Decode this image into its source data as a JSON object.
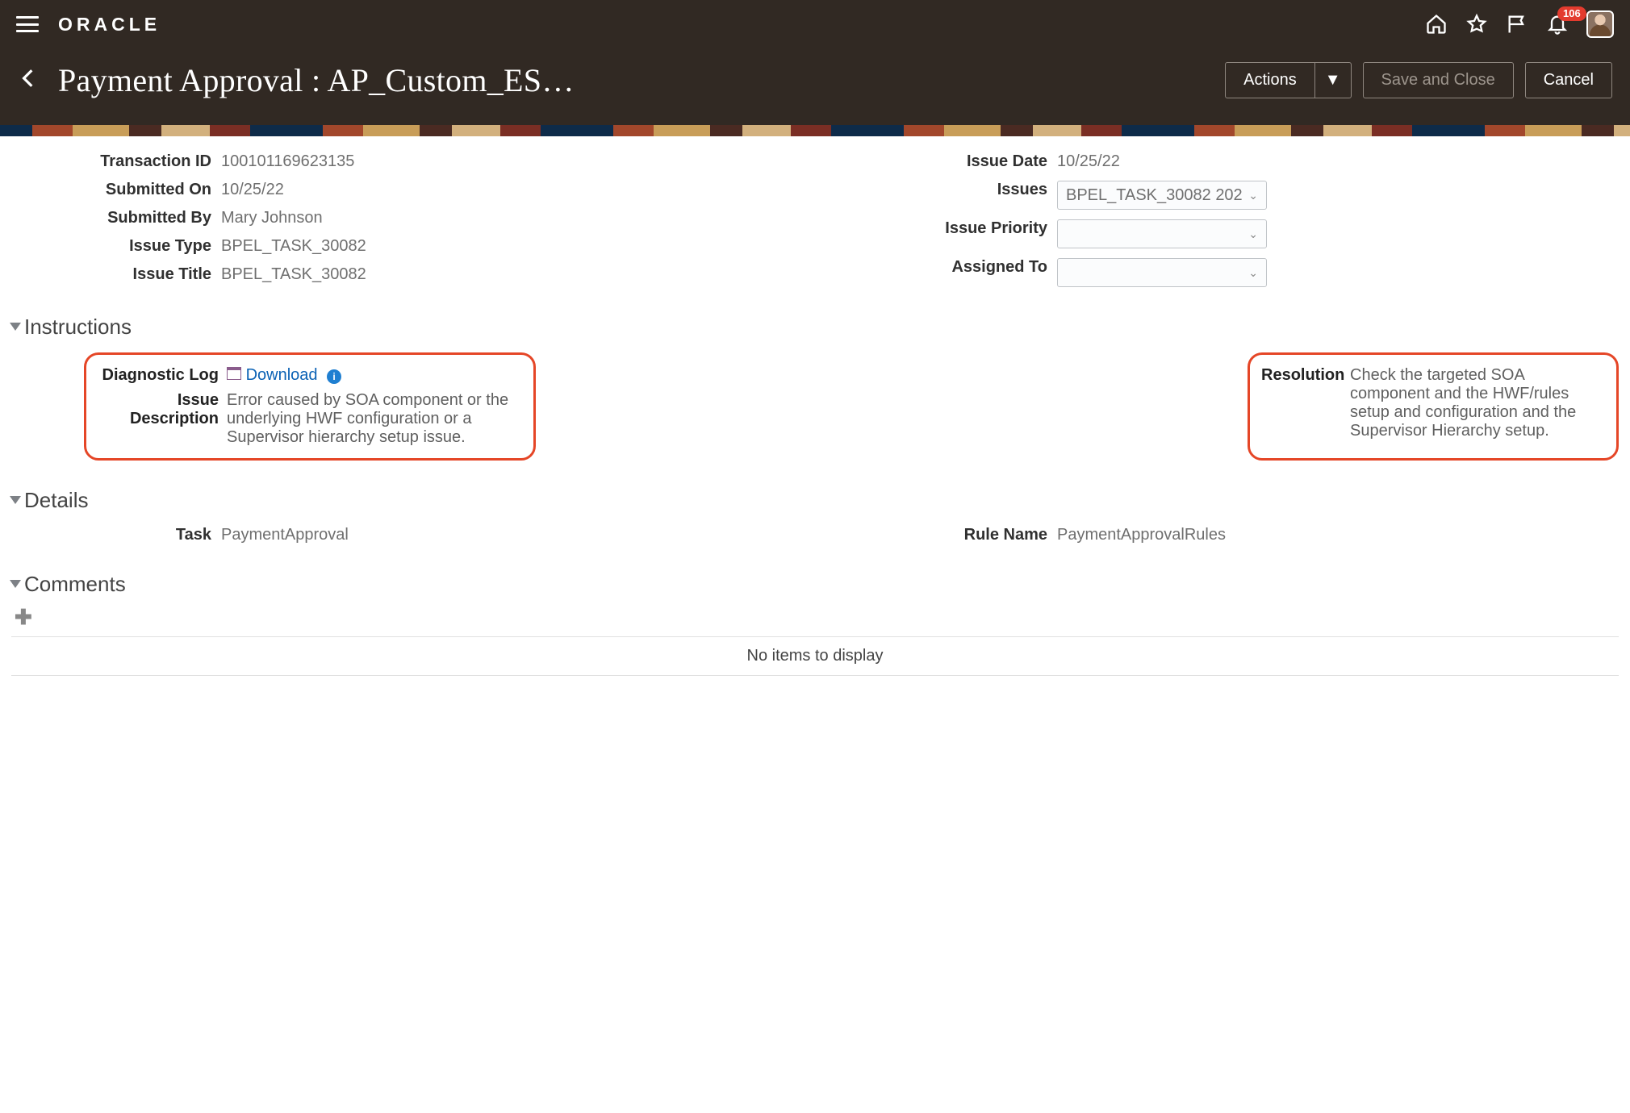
{
  "topbar": {
    "brand": "ORACLE",
    "notification_count": "106"
  },
  "header": {
    "title": "Payment Approval : AP_Custom_ES…",
    "actions_label": "Actions",
    "save_label": "Save and Close",
    "cancel_label": "Cancel"
  },
  "summary": {
    "left": {
      "transaction_id_label": "Transaction ID",
      "transaction_id": "100101169623135",
      "submitted_on_label": "Submitted On",
      "submitted_on": "10/25/22",
      "submitted_by_label": "Submitted By",
      "submitted_by": "Mary Johnson",
      "issue_type_label": "Issue Type",
      "issue_type": "BPEL_TASK_30082",
      "issue_title_label": "Issue Title",
      "issue_title": "BPEL_TASK_30082"
    },
    "right": {
      "issue_date_label": "Issue Date",
      "issue_date": "10/25/22",
      "issues_label": "Issues",
      "issues_value": "BPEL_TASK_30082 202",
      "issue_priority_label": "Issue Priority",
      "issue_priority_value": "",
      "assigned_to_label": "Assigned To",
      "assigned_to_value": ""
    }
  },
  "sections": {
    "instructions": {
      "title": "Instructions",
      "diag_log_label": "Diagnostic Log",
      "download_label": "Download",
      "issue_desc_label": "Issue Description",
      "issue_desc_value": "Error caused by SOA component or the underlying HWF configuration or a Supervisor hierarchy setup issue.",
      "resolution_label": "Resolution",
      "resolution_value": "Check the targeted SOA component and the HWF/rules setup and configuration and the Supervisor Hierarchy setup."
    },
    "details": {
      "title": "Details",
      "task_label": "Task",
      "task_value": "PaymentApproval",
      "rule_name_label": "Rule Name",
      "rule_name_value": "PaymentApprovalRules"
    },
    "comments": {
      "title": "Comments",
      "empty_text": "No items to display"
    }
  }
}
